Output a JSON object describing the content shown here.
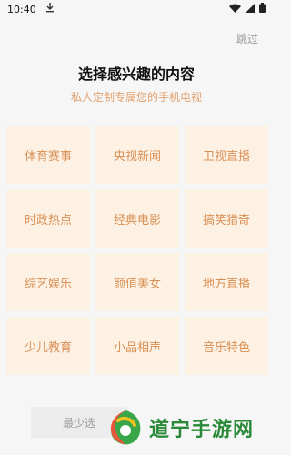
{
  "status_bar": {
    "time": "10:40",
    "icons": [
      "download-icon",
      "wifi-icon",
      "signal-icon",
      "battery-icon"
    ]
  },
  "header": {
    "skip_label": "跳过",
    "title": "选择感兴趣的内容",
    "subtitle": "私人定制专属您的手机电视"
  },
  "categories": [
    "体育赛事",
    "央视新闻",
    "卫视直播",
    "时政热点",
    "经典电影",
    "搞笑猎奇",
    "综艺娱乐",
    "颜值美女",
    "地方直播",
    "少儿教育",
    "小品相声",
    "音乐特色"
  ],
  "bottom": {
    "button_label": "最少选"
  },
  "watermark": {
    "text": "道宁手游网"
  },
  "colors": {
    "accent": "#d99055",
    "tile_bg": "#fdf1e4",
    "background": "#f6f6f6",
    "watermark_green": "#2a8a3a"
  }
}
